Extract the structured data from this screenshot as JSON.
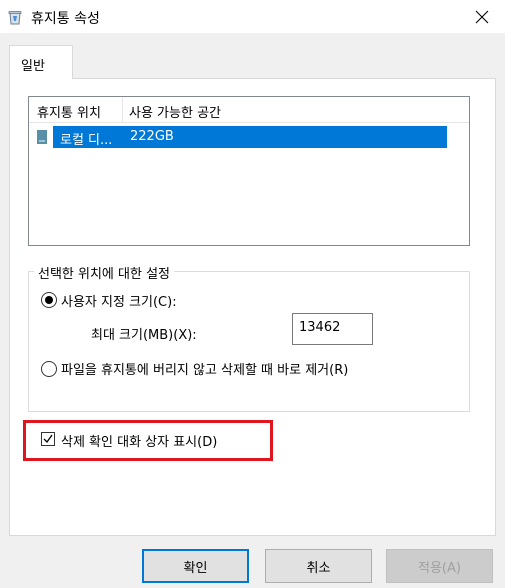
{
  "window": {
    "title": "휴지통 속성",
    "icons": {
      "app": "recycle-bin-icon",
      "close": "close-icon"
    }
  },
  "tabs": [
    {
      "label": "일반",
      "selected": true
    }
  ],
  "list": {
    "headers": [
      "휴지통 위치",
      "사용 가능한 공간"
    ],
    "rows": [
      {
        "location": "로컬 디...",
        "space": "222GB",
        "selected": true,
        "icon": "drive-icon"
      }
    ]
  },
  "settings": {
    "group_title": "선택한 위치에 대한 설정",
    "custom_size_label": "사용자 지정 크기(C):",
    "custom_size_hotkey": "C",
    "max_size_label": "최대 크기(MB)(X):",
    "max_size_value": "13462",
    "no_move_label": "파일을 휴지통에 버리지 않고 삭제할 때 바로 제거(R)",
    "selected_option": "custom_size"
  },
  "confirm": {
    "label": "삭제 확인 대화 상자 표시(D)",
    "checked": true
  },
  "buttons": {
    "ok": "확인",
    "cancel": "취소",
    "apply": "적용(A)"
  },
  "colors": {
    "selection": "#0078d7",
    "highlight_border": "#e0161e"
  }
}
